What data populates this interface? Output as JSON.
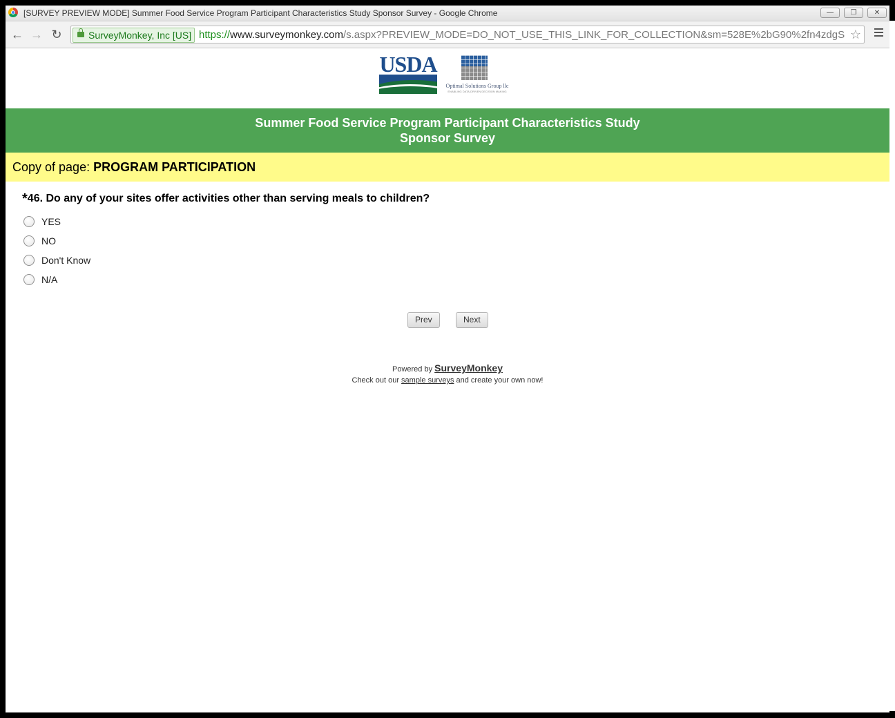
{
  "browser": {
    "window_title": "[SURVEY PREVIEW MODE] Summer Food Service Program Participant Characteristics Study Sponsor Survey - Google Chrome",
    "ev_label": "SurveyMonkey, Inc [US]",
    "url_scheme": "https://",
    "url_host": "www.surveymonkey.com",
    "url_path": "/s.aspx?PREVIEW_MODE=DO_NOT_USE_THIS_LINK_FOR_COLLECTION&sm=528E%2bG90%2fn4zdgS",
    "icons": {
      "back": "←",
      "forward": "→",
      "reload": "↻",
      "star": "☆",
      "minimize": "—",
      "restore": "❐",
      "close": "✕"
    }
  },
  "logos": {
    "usda": "USDA",
    "osg_name": "Optimal Solutions Group llc",
    "osg_tagline": "ENABLING DATA-DRIVEN DECISION MAKING"
  },
  "banner": {
    "line1": "Summer Food Service Program Participant Characteristics Study",
    "line2": "Sponsor Survey"
  },
  "page_heading": {
    "prefix": "Copy of page: ",
    "title": "PROGRAM PARTICIPATION"
  },
  "question": {
    "required_mark": "*",
    "text": "46. Do any of your sites offer activities other than serving meals to children?",
    "options": [
      "YES",
      "NO",
      "Don't Know",
      "N/A"
    ]
  },
  "nav": {
    "prev": "Prev",
    "next": "Next"
  },
  "footer": {
    "powered_by": "Powered by ",
    "brand": "SurveyMonkey",
    "check_out": "Check out our ",
    "link": "sample surveys",
    "create": " and create your own now!"
  },
  "colors": {
    "banner_green": "#4fa454",
    "heading_yellow": "#fffb8a",
    "usda_blue": "#1f4e8c",
    "usda_green": "#1a6f3a"
  }
}
